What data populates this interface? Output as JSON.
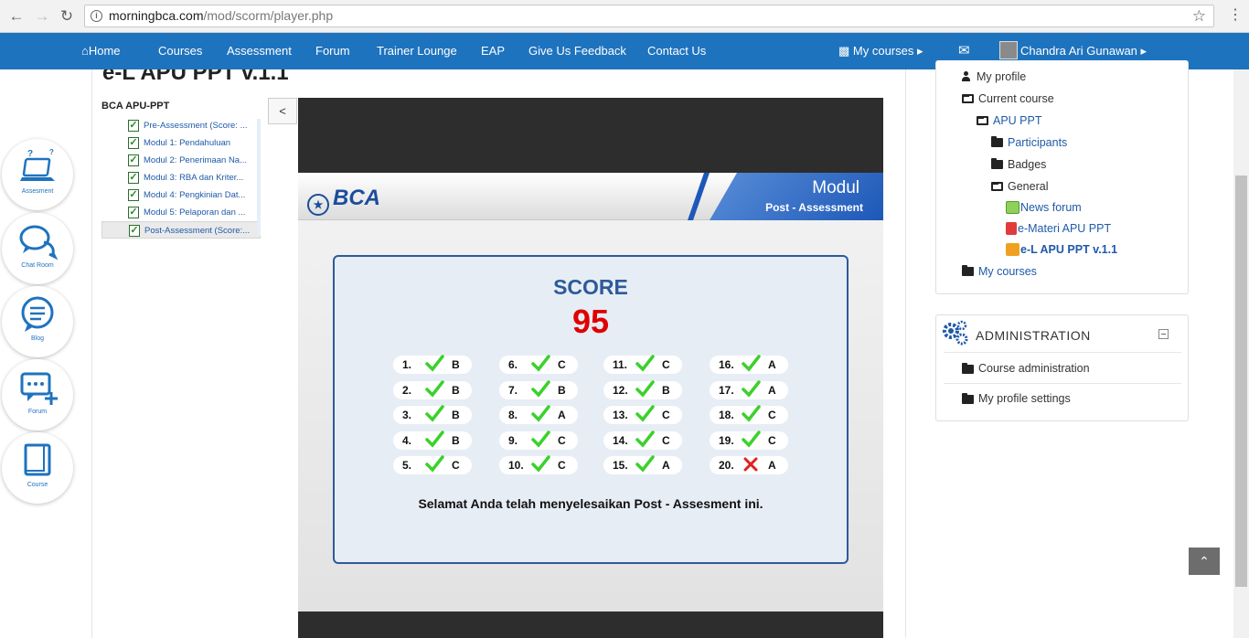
{
  "browser": {
    "url_host": "morningbca.com",
    "url_path": "/mod/scorm/player.php"
  },
  "navbar": {
    "items": [
      "Home",
      "Courses",
      "Assessment",
      "Forum",
      "Trainer Lounge",
      "EAP",
      "Give Us Feedback",
      "Contact Us"
    ],
    "my_courses": "My courses",
    "user_name": "Chandra Ari Gunawan"
  },
  "page": {
    "title": "e-L APU PPT v.1.1"
  },
  "side_fabs": [
    "Assesment",
    "Chat Room",
    "Blog",
    "Forum",
    "Course"
  ],
  "toc": {
    "title": "BCA APU-PPT",
    "items": [
      "Pre-Assessment (Score: ...",
      "Modul 1: Pendahuluan",
      "Modul 2: Penerimaan Na...",
      "Modul 3: RBA dan Kriter...",
      "Modul 4: Pengkinian Dat...",
      "Modul 5: Pelaporan dan ...",
      "Post-Assessment (Score:..."
    ],
    "active_index": 6,
    "toggle_label": "<"
  },
  "slide": {
    "brand": "BCA",
    "header_title": "Modul",
    "header_subtitle": "Post - Assessment",
    "score_label": "SCORE",
    "score_value": "95",
    "message": "Selamat Anda telah menyelesaikan Post - Assesment ini.",
    "answers": [
      {
        "num": "1.",
        "ans": "B",
        "correct": true
      },
      {
        "num": "2.",
        "ans": "B",
        "correct": true
      },
      {
        "num": "3.",
        "ans": "B",
        "correct": true
      },
      {
        "num": "4.",
        "ans": "B",
        "correct": true
      },
      {
        "num": "5.",
        "ans": "C",
        "correct": true
      },
      {
        "num": "6.",
        "ans": "C",
        "correct": true
      },
      {
        "num": "7.",
        "ans": "B",
        "correct": true
      },
      {
        "num": "8.",
        "ans": "A",
        "correct": true
      },
      {
        "num": "9.",
        "ans": "C",
        "correct": true
      },
      {
        "num": "10.",
        "ans": "C",
        "correct": true
      },
      {
        "num": "11.",
        "ans": "C",
        "correct": true
      },
      {
        "num": "12.",
        "ans": "B",
        "correct": true
      },
      {
        "num": "13.",
        "ans": "C",
        "correct": true
      },
      {
        "num": "14.",
        "ans": "C",
        "correct": true
      },
      {
        "num": "15.",
        "ans": "A",
        "correct": true
      },
      {
        "num": "16.",
        "ans": "A",
        "correct": true
      },
      {
        "num": "17.",
        "ans": "A",
        "correct": true
      },
      {
        "num": "18.",
        "ans": "C",
        "correct": true
      },
      {
        "num": "19.",
        "ans": "C",
        "correct": true
      },
      {
        "num": "20.",
        "ans": "A",
        "correct": false
      }
    ]
  },
  "navigation_block": {
    "my_profile": "My profile",
    "current_course": "Current course",
    "course": "APU PPT",
    "participants": "Participants",
    "badges": "Badges",
    "general": "General",
    "news_forum": "News forum",
    "emateri": "e-Materi APU PPT",
    "el": "e-L APU PPT v.1.1",
    "my_courses": "My courses"
  },
  "admin_block": {
    "title": "ADMINISTRATION",
    "course_admin": "Course administration",
    "profile_settings": "My profile settings"
  },
  "colors": {
    "brand_blue": "#1e73be",
    "score_red": "#e00000",
    "check_green": "#3bd12b",
    "cross_red": "#e02020"
  }
}
